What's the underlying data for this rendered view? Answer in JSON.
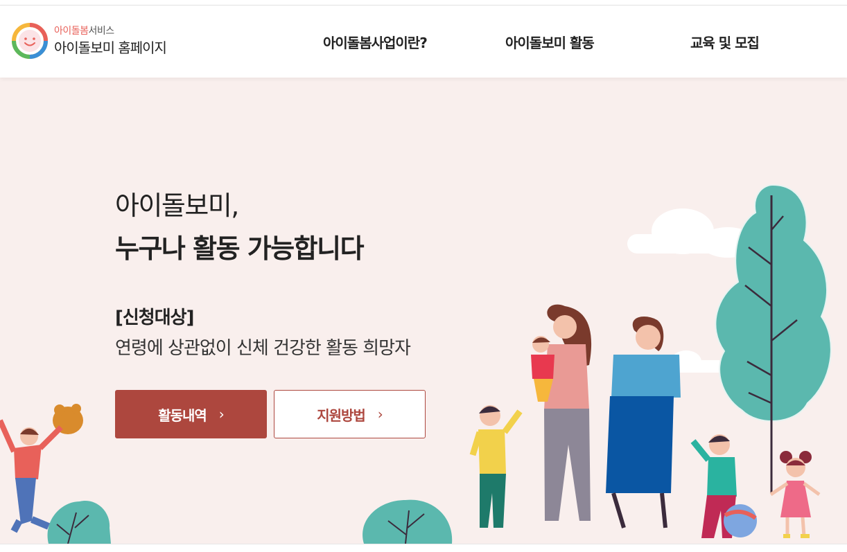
{
  "logo": {
    "sub_accent": "아이돌봄",
    "sub_rest": "서비스",
    "main": "아이돌보미 홈페이지",
    "colors": [
      "#e8615a",
      "#f6b73c",
      "#5cb85c",
      "#3a8fd6"
    ]
  },
  "nav": {
    "items": [
      {
        "label": "아이돌봄사업이란?"
      },
      {
        "label": "아이돌보미 활동"
      },
      {
        "label": "교육 및 모집"
      }
    ]
  },
  "hero": {
    "title_line1": "아이돌보미,",
    "title_line2": "누구나 활동 가능합니다",
    "target_label": "[신청대상]",
    "target_desc": "연령에 상관없이 신체 건강한 활동 희망자",
    "btn_primary": "활동내역",
    "btn_secondary": "지원방법",
    "chevron": "›"
  },
  "colors": {
    "hero_bg": "#f9efed",
    "accent": "#ad473e",
    "tree": "#5bb8ae"
  }
}
